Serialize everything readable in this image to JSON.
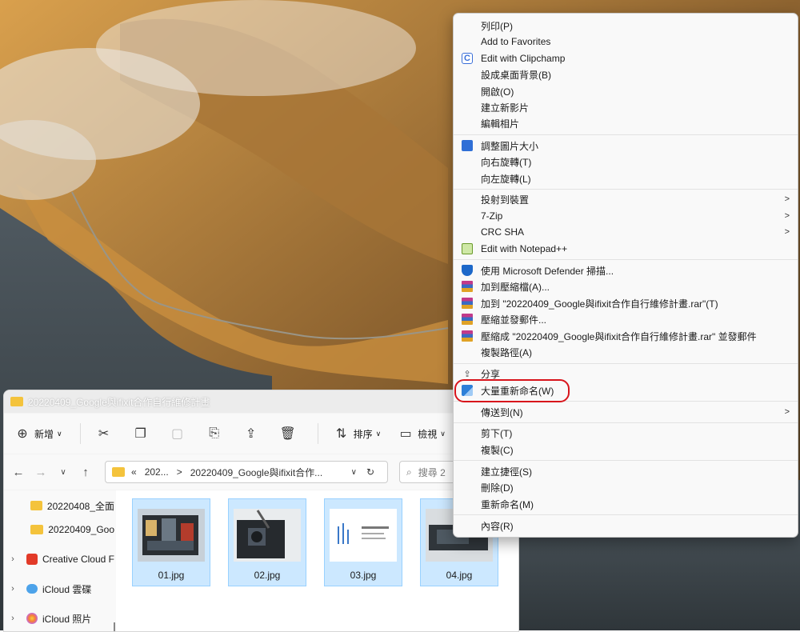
{
  "explorer": {
    "title": "20220409_Google與ifixit合作自行維修計畫",
    "toolbar": {
      "new_label": "新增",
      "sort_label": "排序",
      "view_label": "檢視",
      "more_label": "···"
    },
    "address": {
      "prefix": "«",
      "crumb1": "202...",
      "sep": ">",
      "crumb2": "20220409_Google與ifixit合作...",
      "dropdown": "∨",
      "refresh": "↻"
    },
    "search": {
      "placeholder": "搜尋 2"
    },
    "nav": [
      {
        "label": "20220408_全面"
      },
      {
        "label": "20220409_Goo"
      },
      {
        "label": "Creative Cloud F"
      },
      {
        "label": "iCloud 雲碟"
      },
      {
        "label": "iCloud 照片"
      }
    ],
    "files": [
      {
        "name": "01.jpg"
      },
      {
        "name": "02.jpg"
      },
      {
        "name": "03.jpg"
      },
      {
        "name": "04.jpg"
      }
    ]
  },
  "context_menu": {
    "items": [
      {
        "label": "列印(P)"
      },
      {
        "label": "Add to Favorites"
      },
      {
        "label": "Edit with Clipchamp",
        "icon": "clipchamp-icon"
      },
      {
        "label": "設成桌面背景(B)"
      },
      {
        "label": "開啟(O)"
      },
      {
        "label": "建立新影片"
      },
      {
        "label": "編輯相片"
      },
      {
        "label": "調整圖片大小",
        "icon": "image-resize-icon"
      },
      {
        "label": "向右旋轉(T)"
      },
      {
        "label": "向左旋轉(L)"
      },
      {
        "label": "投射到裝置",
        "submenu": true
      },
      {
        "label": "7-Zip",
        "submenu": true
      },
      {
        "label": "CRC SHA",
        "submenu": true
      },
      {
        "label": "Edit with Notepad++",
        "icon": "notepad-plus-plus-icon"
      },
      {
        "label": "使用 Microsoft Defender 掃描...",
        "icon": "defender-shield-icon"
      },
      {
        "label": "加到壓縮檔(A)...",
        "icon": "winrar-icon"
      },
      {
        "label": "加到 \"20220409_Google與ifixit合作自行維修計畫.rar\"(T)",
        "icon": "winrar-icon"
      },
      {
        "label": "壓縮並發郵件...",
        "icon": "winrar-icon"
      },
      {
        "label": "壓縮成 \"20220409_Google與ifixit合作自行維修計畫.rar\" 並發郵件",
        "icon": "winrar-icon"
      },
      {
        "label": "複製路徑(A)"
      },
      {
        "label": "分享",
        "icon": "share-icon"
      },
      {
        "label": "大量重新命名(W)",
        "icon": "powertoys-rename-icon"
      },
      {
        "label": "傳送到(N)",
        "submenu": true
      },
      {
        "label": "剪下(T)"
      },
      {
        "label": "複製(C)"
      },
      {
        "label": "建立捷徑(S)"
      },
      {
        "label": "刪除(D)"
      },
      {
        "label": "重新命名(M)"
      },
      {
        "label": "內容(R)"
      }
    ],
    "submenu_arrow": ">"
  },
  "annotation_color": "#d8141b"
}
